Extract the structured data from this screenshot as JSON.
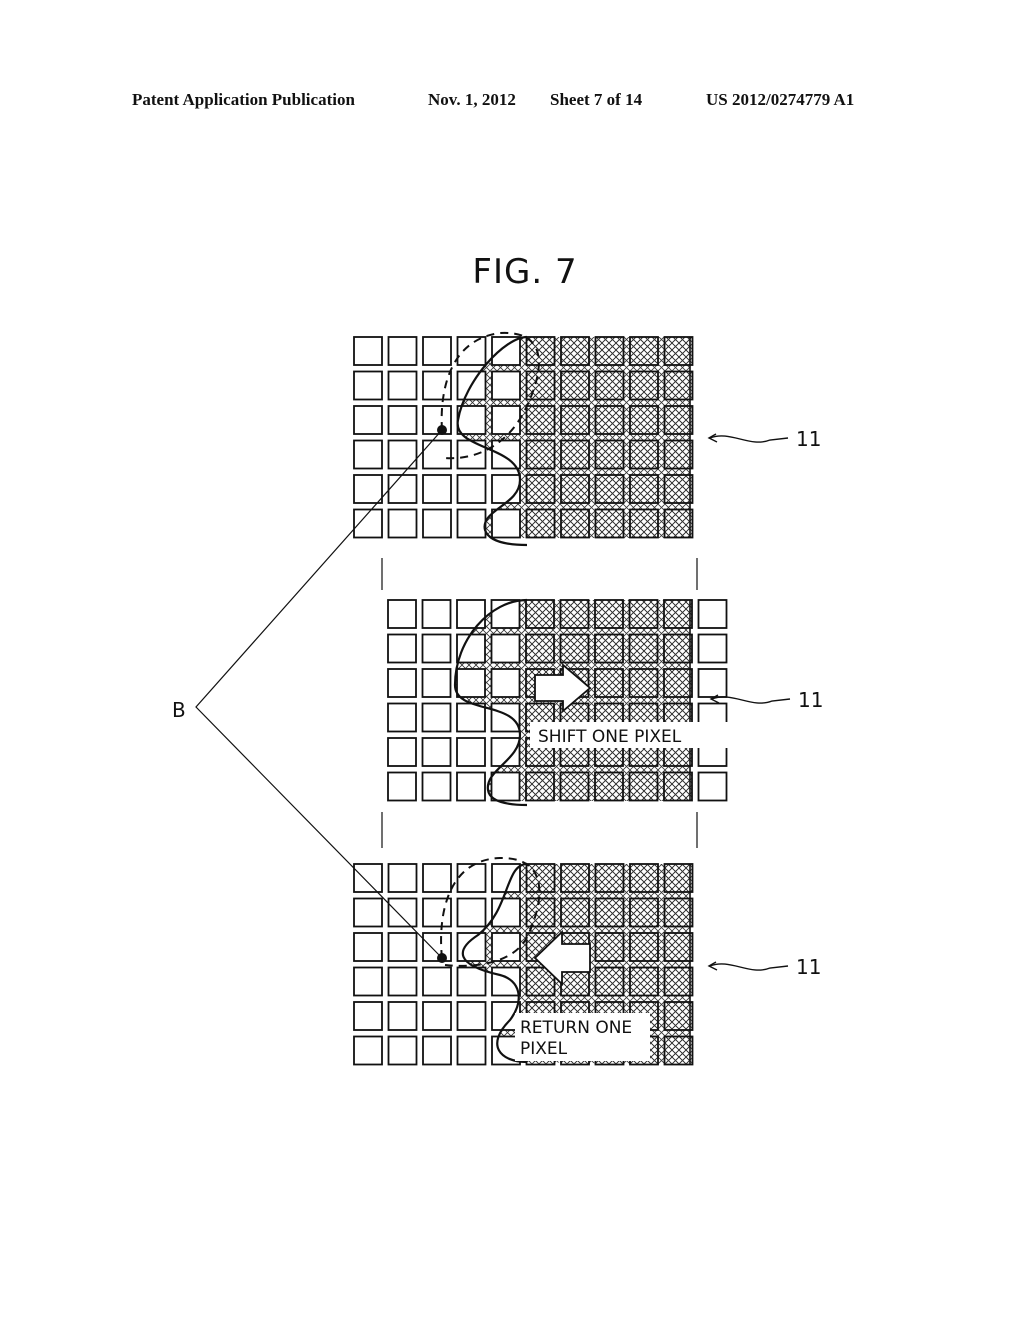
{
  "header": {
    "publication": "Patent Application Publication",
    "date": "Nov. 1, 2012",
    "sheet": "Sheet 7 of 14",
    "number": "US 2012/0274779 A1"
  },
  "figure": {
    "title": "FIG. 7",
    "panels": [
      {
        "id": "top",
        "reference": "11",
        "grid": {
          "rows": 6,
          "cols": 10
        },
        "annotation": ""
      },
      {
        "id": "middle",
        "reference": "11",
        "grid": {
          "rows": 6,
          "cols": 10
        },
        "annotation": "SHIFT ONE PIXEL",
        "arrow": "right"
      },
      {
        "id": "bottom",
        "reference": "11",
        "grid": {
          "rows": 6,
          "cols": 10
        },
        "annotation_lines": [
          "RETURN ONE",
          "PIXEL"
        ],
        "arrow": "left"
      }
    ],
    "point_label": "B"
  },
  "colors": {
    "ink": "#111111",
    "paper": "#ffffff"
  }
}
